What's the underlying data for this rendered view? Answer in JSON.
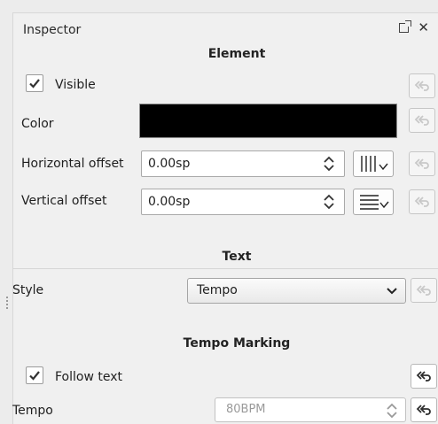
{
  "panel": {
    "title": "Inspector"
  },
  "element": {
    "header": "Element",
    "visible_label": "Visible",
    "visible_checked": true,
    "color_label": "Color",
    "color_value": "#000000",
    "h_offset_label": "Horizontal offset",
    "h_offset_value": "0.00sp",
    "v_offset_label": "Vertical offset",
    "v_offset_value": "0.00sp"
  },
  "text": {
    "header": "Text",
    "style_label": "Style",
    "style_value": "Tempo"
  },
  "tempo": {
    "header": "Tempo Marking",
    "follow_text_label": "Follow text",
    "follow_text_checked": true,
    "tempo_label": "Tempo",
    "tempo_value": "80BPM"
  },
  "icons": {
    "float": "float-icon",
    "close": "close-icon",
    "reset": "reset-icon",
    "snap_grid": "snap-to-grid-icon",
    "spin": "spin-arrows-icon",
    "chevron": "chevron-down-icon",
    "check": "check-icon"
  }
}
